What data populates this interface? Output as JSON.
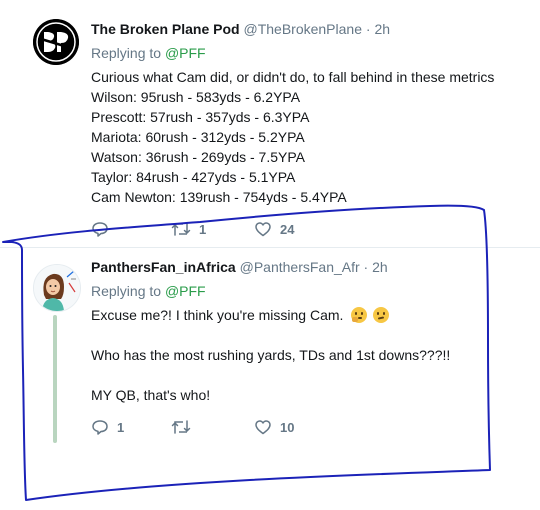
{
  "tweet1": {
    "display_name": "The Broken Plane Pod",
    "handle": "@TheBrokenPlane",
    "separator": "·",
    "time": "2h",
    "replying_prefix": "Replying to",
    "replying_to": "@PFF",
    "lines": [
      "Curious what Cam did, or didn't do, to fall behind in these metrics",
      "Wilson: 95rush - 583yds - 6.2YPA",
      "Prescott: 57rush - 357yds - 6.3YPA",
      "Mariota: 60rush - 312yds - 5.2YPA",
      "Watson: 36rush - 269yds - 7.5YPA",
      "Taylor: 84rush - 427yds - 5.1YPA",
      "Cam Newton: 139rush - 754yds - 5.4YPA"
    ],
    "actions": {
      "reply_count": "",
      "retweet_count": "1",
      "like_count": "24"
    },
    "avatar_icon": "broken-plane-logo"
  },
  "tweet2": {
    "display_name": "PanthersFan_inAfrica",
    "handle": "@PanthersFan_Afr",
    "separator": "·",
    "time": "2h",
    "replying_prefix": "Replying to",
    "replying_to": "@PFF",
    "line1": "Excuse me?! I think you're missing Cam.",
    "line2": "Who has the most rushing yards, TDs and 1st downs???!!",
    "line3": "MY QB, that's who!",
    "emojis": [
      "thinking-face-emoji",
      "confused-face-emoji"
    ],
    "actions": {
      "reply_count": "1",
      "retweet_count": "",
      "like_count": "10"
    },
    "avatar_icon": "cartoon-woman-avatar"
  },
  "colors": {
    "text": "#14171a",
    "secondary": "#657786",
    "mention": "#2a9c4a",
    "thread_line": "#b9d5bf",
    "annotation": "#1b22b8"
  }
}
